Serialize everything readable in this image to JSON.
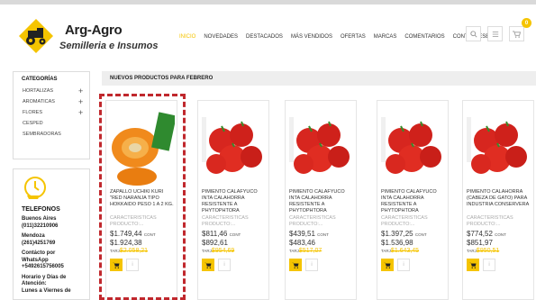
{
  "colors": {
    "accent": "#f5c400",
    "highlight_dash": "#c0282d"
  },
  "brand": {
    "name": "Arg-Agro",
    "tagline": "Semilleria e Insumos",
    "logo_icon": "tractor-logo-icon"
  },
  "nav": {
    "items": [
      {
        "label": "INICIO",
        "active": true
      },
      {
        "label": "NOVEDADES"
      },
      {
        "label": "DESTACADOS"
      },
      {
        "label": "MÁS VENDIDOS"
      },
      {
        "label": "OFERTAS"
      },
      {
        "label": "MARCAS"
      },
      {
        "label": "COMENTARIOS"
      },
      {
        "label": "CONTACTESE"
      }
    ]
  },
  "header_buttons": {
    "search_icon": "search-icon",
    "menu_icon": "menu-icon",
    "cart_icon": "cart-icon",
    "cart_count": "0"
  },
  "sidebar": {
    "title": "CATEGORÍAS",
    "items": [
      {
        "label": "HORTALIZAS",
        "expandable": true
      },
      {
        "label": "AROMATICAS",
        "expandable": true
      },
      {
        "label": "FLORES",
        "expandable": true
      },
      {
        "label": "CESPED",
        "expandable": false
      },
      {
        "label": "SEMBRADORAS",
        "expandable": false
      }
    ]
  },
  "contact": {
    "icon": "phone-clock-icon",
    "title": "TELEFONOS",
    "lines": [
      "Buenos Aires",
      "(011)32210906",
      "",
      "Mendoza",
      "(261)4251769",
      "",
      "Contácto por",
      "WhatsApp",
      "+5492615756005",
      "",
      "Horario y Días de",
      "Atención:",
      "Lunes a Viernes de"
    ]
  },
  "main": {
    "section_title": "NUEVOS PRODUCTOS PARA FEBRERO"
  },
  "products": [
    {
      "name": "ZAPALLO UCHIKI KURI \"RED NARANJA TIPO HOKKAIDO PESO 1 A 2 KG.",
      "desc": "CARACTERISTICAS PRODUCTO:...",
      "price": "$1.749,44",
      "price_suffix": "CONT",
      "price2": "$1.924,38",
      "old_label": "TARJ",
      "old_price": "$2.058,21",
      "image": "pumpkin"
    },
    {
      "name": "PIMIENTO CALAFYUCO INTA CALAHORRA RESISTENTE A PHYTOPHTORA",
      "desc": "CARACTERISTICAS PRODUCTO:...",
      "price": "$811,46",
      "price_suffix": "CONT",
      "price2": "$892,61",
      "old_label": "TARJ",
      "old_price": "$954,69",
      "image": "pepper"
    },
    {
      "name": "PIMIENTO CALAFYUCO INTA CALAHORRA RESISTENTE A PHYTOPHTORA",
      "desc": "CARACTERISTICAS PRODUCTO:...",
      "price": "$439,51",
      "price_suffix": "CONT",
      "price2": "$483,46",
      "old_label": "TARJ",
      "old_price": "$517,07",
      "image": "pepper"
    },
    {
      "name": "PIMIENTO CALAFYUCO INTA CALAHORRA RESISTENTE A PHYTOPHTORA",
      "desc": "CARACTERISTICAS PRODUCTO:...",
      "price": "$1.397,25",
      "price_suffix": "CONT",
      "price2": "$1.536,98",
      "old_label": "TARJ",
      "old_price": "$1.643,45",
      "image": "pepper"
    },
    {
      "name": "PIMIENTO CALAHORRA (CABEZA DE GATO) PARA INDUSTRIA CONSERVERA",
      "desc": "CARACTERISTICAS PRODUCTO:...",
      "price": "$774,52",
      "price_suffix": "CONT",
      "price2": "$851,97",
      "old_label": "TARJ",
      "old_price": "$950,51",
      "image": "pepper"
    }
  ]
}
